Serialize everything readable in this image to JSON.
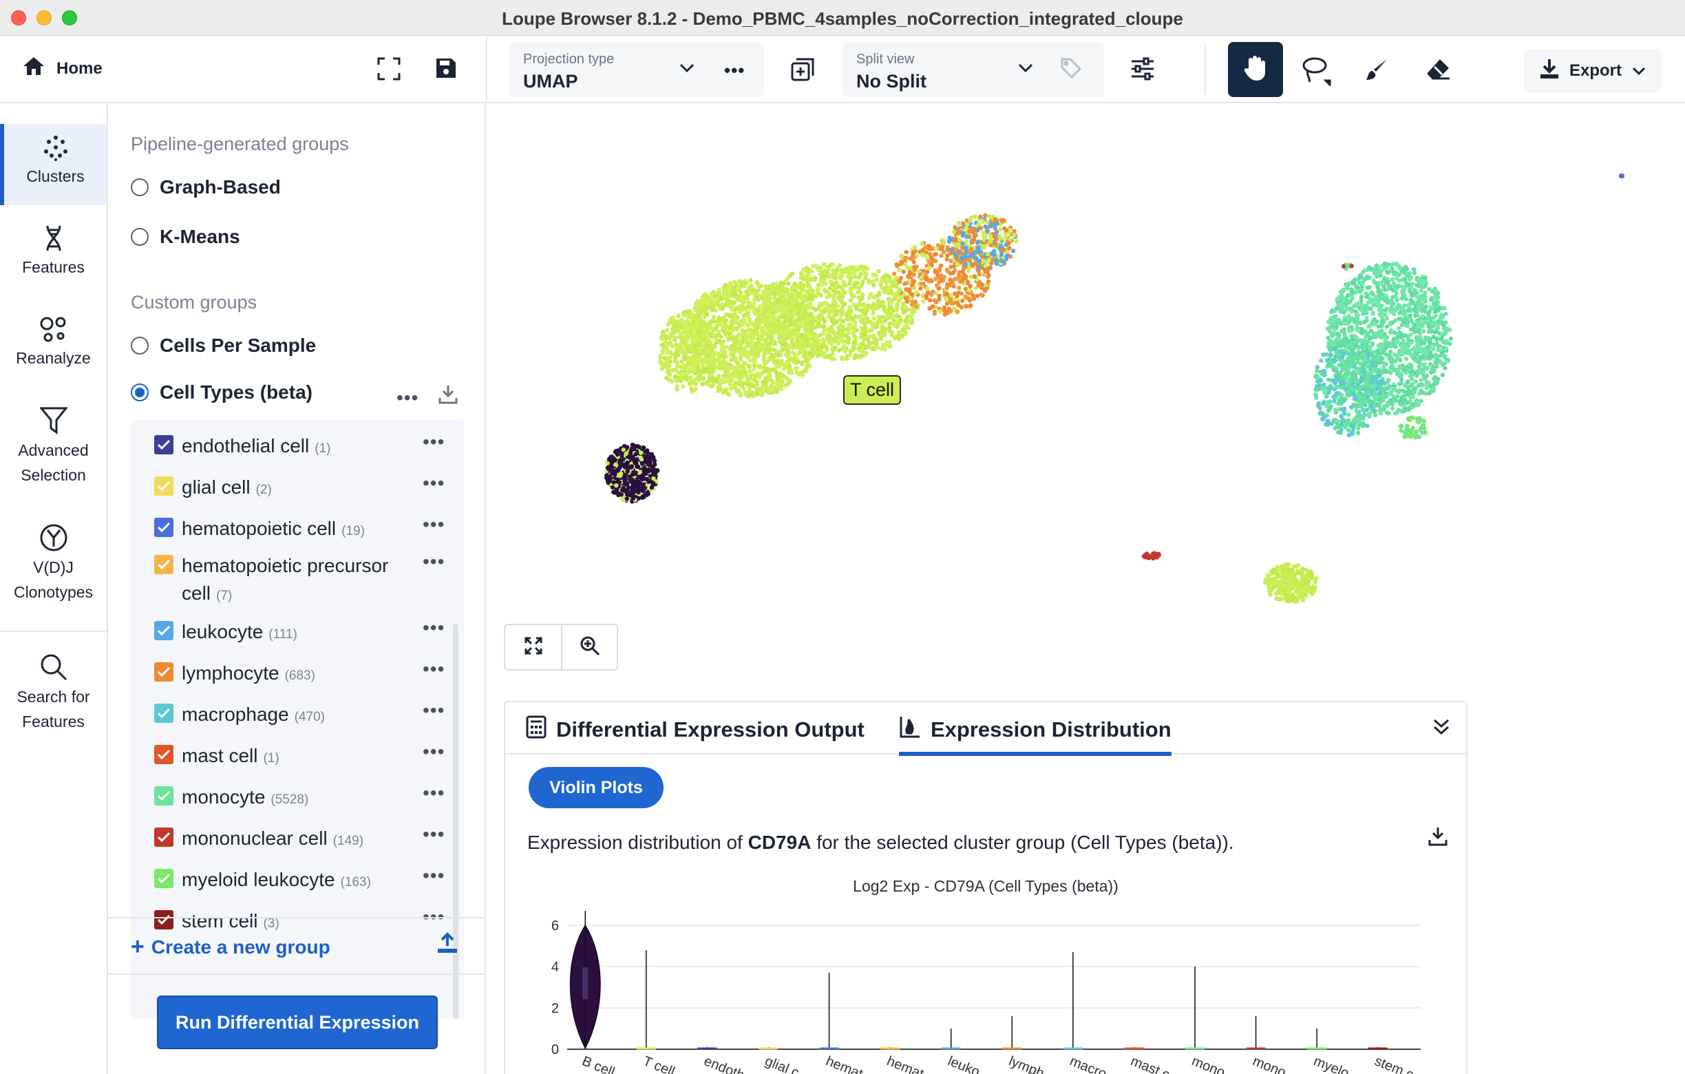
{
  "window": {
    "title": "Loupe Browser 8.1.2 - Demo_PBMC_4samples_noCorrection_integrated_cloupe"
  },
  "toolbar": {
    "home_label": "Home",
    "projection": {
      "label": "Projection type",
      "value": "UMAP"
    },
    "split": {
      "label": "Split view",
      "value": "No Split"
    },
    "export_label": "Export",
    "colors": {
      "active_tool_bg": "#142a45",
      "accent": "#1e5fc4"
    }
  },
  "navrail": {
    "items": [
      {
        "label": "Clusters",
        "icon": "clusters-icon"
      },
      {
        "label": "Features",
        "icon": "dna-icon"
      },
      {
        "label": "Reanalyze",
        "icon": "reanalyze-icon"
      },
      {
        "label": "Advanced Selection",
        "icon": "funnel-icon"
      },
      {
        "label": "V(D)J Clonotypes",
        "icon": "antibody-icon"
      },
      {
        "label": "Search for Features",
        "icon": "search-icon"
      }
    ]
  },
  "groups": {
    "pipeline_title": "Pipeline-generated groups",
    "pipeline": [
      "Graph-Based",
      "K-Means"
    ],
    "custom_title": "Custom groups",
    "custom": [
      "Cells Per Sample",
      "Cell Types (beta)"
    ],
    "selected": "Cell Types (beta)",
    "cell_types": [
      {
        "name": "endothelial cell",
        "count": "(1)",
        "color": "#3a3f9a"
      },
      {
        "name": "glial cell",
        "count": "(2)",
        "color": "#f0dc5a"
      },
      {
        "name": "hematopoietic cell",
        "count": "(19)",
        "color": "#4a6fdc"
      },
      {
        "name": "hematopoietic precursor cell",
        "count": "(7)",
        "color": "#f5b54a"
      },
      {
        "name": "leukocyte",
        "count": "(111)",
        "color": "#58a8e6"
      },
      {
        "name": "lymphocyte",
        "count": "(683)",
        "color": "#ef8a34"
      },
      {
        "name": "macrophage",
        "count": "(470)",
        "color": "#5cc8d6"
      },
      {
        "name": "mast cell",
        "count": "(1)",
        "color": "#e0552a"
      },
      {
        "name": "monocyte",
        "count": "(5528)",
        "color": "#6ee39a"
      },
      {
        "name": "mononuclear cell",
        "count": "(149)",
        "color": "#c0392b"
      },
      {
        "name": "myeloid leukocyte",
        "count": "(163)",
        "color": "#7ee86a"
      },
      {
        "name": "stem cell",
        "count": "(3)",
        "color": "#8b1e1e"
      }
    ],
    "create_label": "Create a new group",
    "run_de_label": "Run Differential Expression"
  },
  "plot": {
    "tcell_label": "T cell"
  },
  "bottom": {
    "tab_de": "Differential Expression Output",
    "tab_expr": "Expression Distribution",
    "violin_button": "Violin Plots",
    "desc_prefix": "Expression distribution of ",
    "gene": "CD79A",
    "desc_suffix": " for the selected cluster group (Cell Types (beta)).",
    "chart_title": "Log2 Exp - CD79A (Cell Types (beta))"
  },
  "chart_data": {
    "type": "violin",
    "title": "Log2 Exp - CD79A (Cell Types (beta))",
    "xlabel": "",
    "ylabel": "",
    "ylim": [
      0,
      7
    ],
    "yticks": [
      0,
      2,
      4,
      6
    ],
    "grid": true,
    "categories": [
      "B cell",
      "T cell",
      "endoth",
      "glial c",
      "hemat",
      "hemat",
      "leuko",
      "lymph",
      "macro",
      "mast c",
      "mono",
      "mono",
      "myelo",
      "stem c"
    ],
    "max_values": [
      6.7,
      4.8,
      0.1,
      0.1,
      3.7,
      0.1,
      1.0,
      1.6,
      4.7,
      0.1,
      4.0,
      1.6,
      1.0,
      0.1
    ],
    "median_values": [
      3.2,
      0,
      0,
      0,
      0,
      0,
      0,
      0,
      0,
      0,
      0,
      0,
      0,
      0
    ],
    "colors": [
      "#2b0f3f",
      "#ccee55",
      "#3a3f9a",
      "#f0dc5a",
      "#4a6fdc",
      "#f5b54a",
      "#58a8e6",
      "#ef8a34",
      "#5cc8d6",
      "#e0552a",
      "#6ee39a",
      "#c0392b",
      "#7ee86a",
      "#8b1e1e"
    ]
  }
}
